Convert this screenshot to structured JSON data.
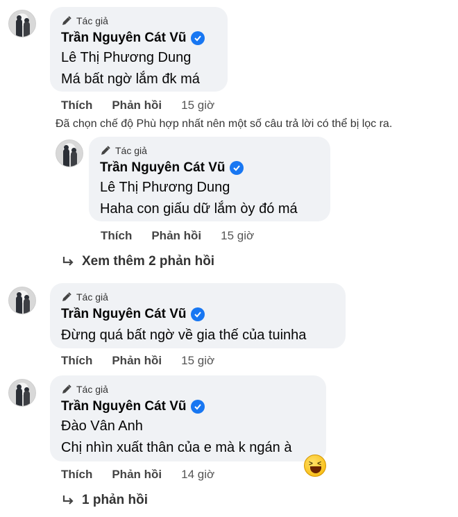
{
  "comments": [
    {
      "author_tag": "Tác giả",
      "author_name": "Trần Nguyên Cát Vũ",
      "mention": "Lê Thị Phương Dung",
      "text": "Má bất ngờ lắm đk má",
      "like_label": "Thích",
      "reply_label": "Phản hồi",
      "time": "15 giờ"
    },
    {
      "author_tag": "Tác giả",
      "author_name": "Trần Nguyên Cát Vũ",
      "mention": "Lê Thị Phương Dung",
      "text": "Haha con giấu dữ lắm òy đó má",
      "like_label": "Thích",
      "reply_label": "Phản hồi",
      "time": "15 giờ"
    },
    {
      "author_tag": "Tác giả",
      "author_name": "Trần Nguyên Cát Vũ",
      "text": "Đừng quá bất ngờ về gia thế của tuinha",
      "like_label": "Thích",
      "reply_label": "Phản hồi",
      "time": "15 giờ"
    },
    {
      "author_tag": "Tác giả",
      "author_name": "Trần Nguyên Cát Vũ",
      "mention": "Đào Vân Anh",
      "text": "Chị nhìn xuất thân của e mà k ngán à",
      "like_label": "Thích",
      "reply_label": "Phản hồi",
      "time": "14 giờ",
      "reaction_icon": "laughing-emoji-icon"
    }
  ],
  "filter_note": "Đã chọn chế độ Phù hợp nhất nên một số câu trả lời có thể bị lọc ra.",
  "view_more_replies": "Xem thêm 2 phản hồi",
  "replies_count": "1 phản hồi",
  "colors": {
    "bubble": "#f0f2f5",
    "verified": "#1877f2"
  }
}
